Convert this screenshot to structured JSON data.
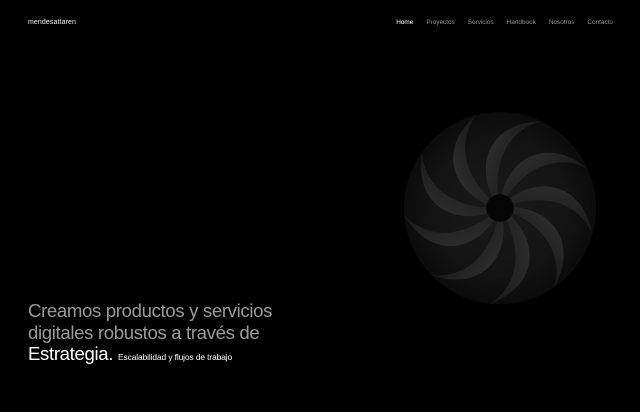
{
  "brand": {
    "logo": "mendesattaren"
  },
  "nav": {
    "items": [
      {
        "label": "Home",
        "active": true
      },
      {
        "label": "Proyectos",
        "active": false
      },
      {
        "label": "Servicios",
        "active": false
      },
      {
        "label": "Handbook",
        "active": false
      },
      {
        "label": "Nosotros",
        "active": false
      },
      {
        "label": "Contacto",
        "active": false
      }
    ]
  },
  "hero": {
    "line1": "Creamos productos y servicios",
    "line2": "digitales robustos a través de",
    "highlight": "Estrategia.",
    "tagline": "Escalabilidad y flujos de trabajo"
  },
  "colors": {
    "background": "#000000",
    "text_primary": "#ffffff",
    "text_muted": "#9a9a9a",
    "nav_muted": "#8e8e8e"
  }
}
